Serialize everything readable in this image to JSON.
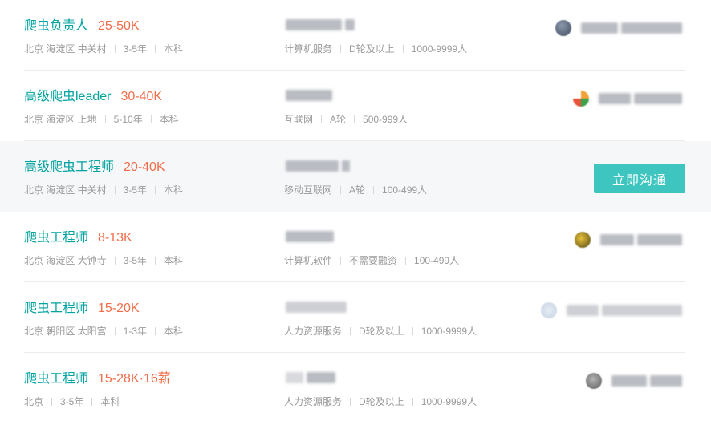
{
  "jobs": [
    {
      "title": "爬虫负责人",
      "salary": "25-50K",
      "location": "北京 海淀区 中关村",
      "experience": "3-5年",
      "education": "本科",
      "industry": "计算机服务",
      "stage": "D轮及以上",
      "size": "1000-9999人"
    },
    {
      "title": "高级爬虫leader",
      "salary": "30-40K",
      "location": "北京 海淀区 上地",
      "experience": "5-10年",
      "education": "本科",
      "industry": "互联网",
      "stage": "A轮",
      "size": "500-999人"
    },
    {
      "title": "高级爬虫工程师",
      "salary": "20-40K",
      "location": "北京 海淀区 中关村",
      "experience": "3-5年",
      "education": "本科",
      "industry": "移动互联网",
      "stage": "A轮",
      "size": "100-499人",
      "chat_label": "立即沟通"
    },
    {
      "title": "爬虫工程师",
      "salary": "8-13K",
      "location": "北京 海淀区 大钟寺",
      "experience": "3-5年",
      "education": "本科",
      "industry": "计算机软件",
      "stage": "不需要融资",
      "size": "100-499人"
    },
    {
      "title": "爬虫工程师",
      "salary": "15-20K",
      "location": "北京 朝阳区 太阳宫",
      "experience": "1-3年",
      "education": "本科",
      "industry": "人力资源服务",
      "stage": "D轮及以上",
      "size": "1000-9999人"
    },
    {
      "title": "爬虫工程师",
      "salary": "15-28K·16薪",
      "location": "北京",
      "experience": "3-5年",
      "education": "本科",
      "industry": "人力资源服务",
      "stage": "D轮及以上",
      "size": "1000-9999人"
    }
  ],
  "colors": {
    "title": "#00a3a0",
    "salary": "#f26d49",
    "meta": "#9a9a9a",
    "button": "#3fc5c0",
    "hover_bg": "#f6f7f9"
  }
}
